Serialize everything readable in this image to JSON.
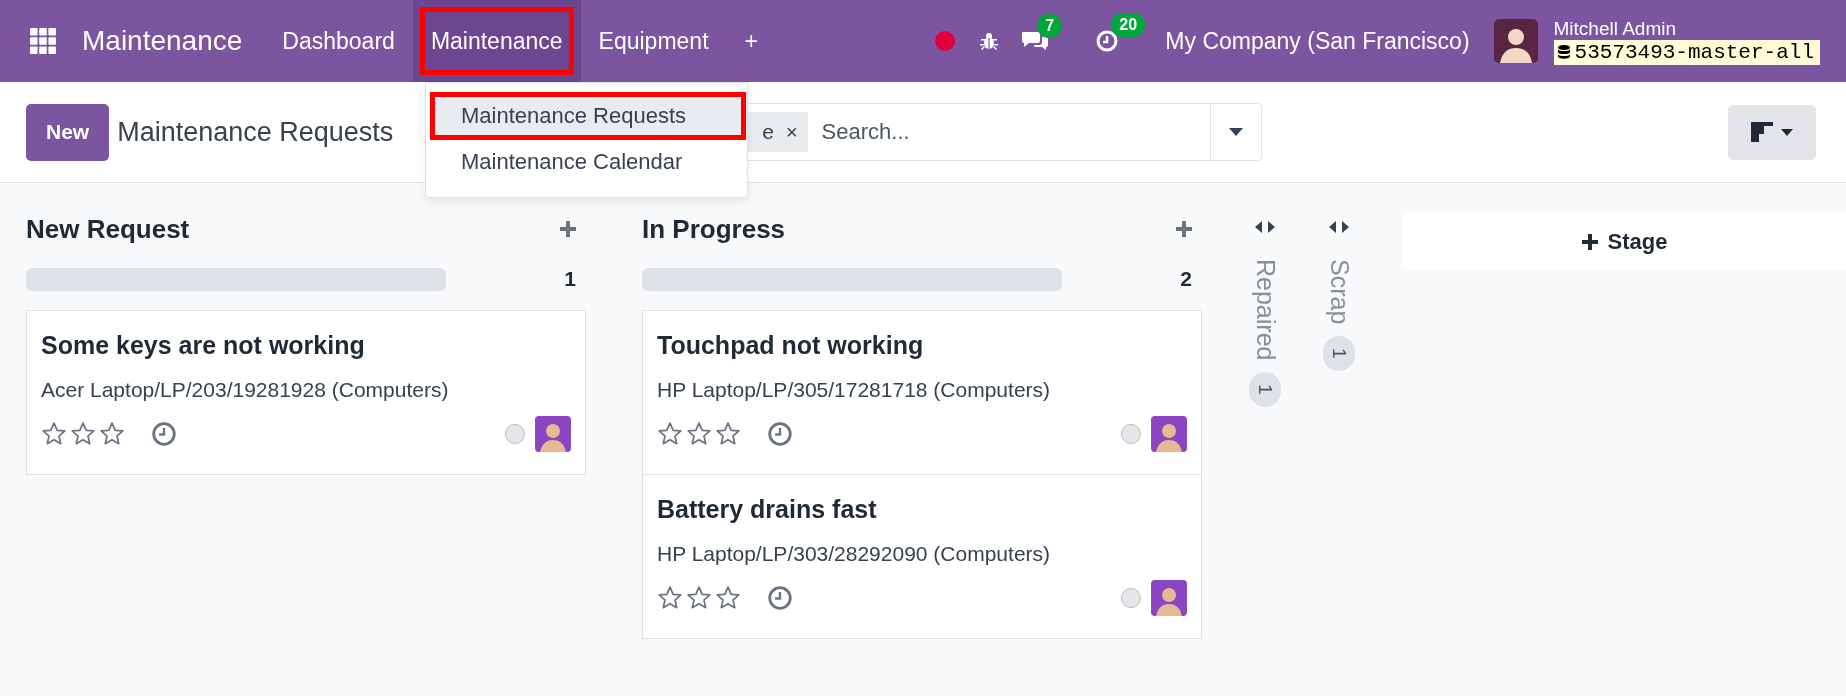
{
  "navbar": {
    "app_name": "Maintenance",
    "menus": [
      {
        "label": "Dashboard",
        "selected": false,
        "annotated": false
      },
      {
        "label": "Maintenance",
        "selected": true,
        "annotated": true
      },
      {
        "label": "Equipment",
        "selected": false,
        "annotated": false
      },
      {
        "label": "+",
        "selected": false,
        "annotated": false
      }
    ],
    "chat_count": "7",
    "activity_count": "20",
    "company": "My Company (San Francisco)",
    "user": "Mitchell Admin",
    "database": "53573493-master-all"
  },
  "dropdown": [
    {
      "label": "Maintenance Requests",
      "selected": true,
      "annotated": true
    },
    {
      "label": "Maintenance Calendar",
      "selected": false,
      "annotated": false
    }
  ],
  "control_panel": {
    "new_button": "New",
    "title": "Maintenance Requests",
    "search": {
      "facet": "e",
      "facet_close": "×",
      "placeholder": "Search..."
    }
  },
  "columns": [
    {
      "title": "New Request",
      "folded": false,
      "count": "1",
      "level": 0,
      "cards": [
        {
          "title": "Some keys are not working",
          "equipment": "Acer Laptop/LP/203/19281928 (Computers)",
          "stars": 0
        }
      ]
    },
    {
      "title": "In Progress",
      "folded": false,
      "count": "2",
      "level": 0,
      "cards": [
        {
          "title": "Touchpad not working",
          "equipment": "HP Laptop/LP/305/17281718 (Computers)",
          "stars": 0
        },
        {
          "title": "Battery drains fast",
          "equipment": "HP Laptop/LP/303/28292090 (Computers)",
          "stars": 0
        }
      ]
    },
    {
      "title": "Repaired",
      "folded": true,
      "count": "1"
    },
    {
      "title": "Scrap",
      "folded": true,
      "count": "1"
    }
  ],
  "add_stage": "Stage"
}
